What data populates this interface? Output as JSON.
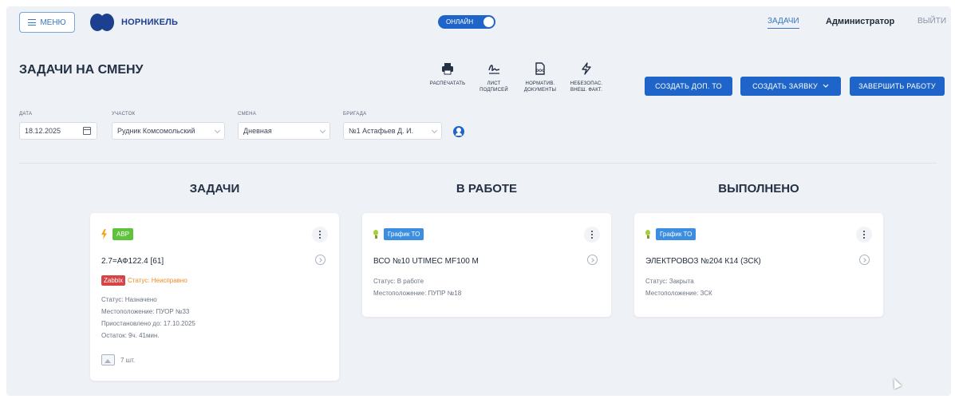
{
  "header": {
    "menu_label": "МЕНЮ",
    "logo_text": "НОРНИКЕЛЬ",
    "online_label": "ОНЛАЙН",
    "nav_tasks": "ЗАДАЧИ",
    "nav_admin": "Администратор",
    "nav_exit": "ВЫЙТИ"
  },
  "page": {
    "title": "ЗАДАЧИ НА СМЕНУ"
  },
  "tools": [
    {
      "icon": "printer-icon",
      "label_1": "РАСПЕЧАТАТЬ",
      "label_2": ""
    },
    {
      "icon": "signature-icon",
      "label_1": "ЛИСТ",
      "label_2": "ПОДПИСЕЙ"
    },
    {
      "icon": "document-icon",
      "label_1": "НОРМАТИВ.",
      "label_2": "ДОКУМЕНТЫ"
    },
    {
      "icon": "lightning-icon",
      "label_1": "НЕБЕЗОПАС.",
      "label_2": "ВНЕШ. ФАКТ."
    }
  ],
  "actions": {
    "create_extra_to": "СОЗДАТЬ ДОП. ТО",
    "create_request": "СОЗДАТЬ ЗАЯВКУ",
    "finish_work": "ЗАВЕРШИТЬ РАБОТУ"
  },
  "filters": {
    "date_label": "ДАТА",
    "date_value": "18.12.2025",
    "area_label": "УЧАСТОК",
    "area_value": "Рудник Комсомольский",
    "shift_label": "СМЕНА",
    "shift_value": "Дневная",
    "crew_label": "БРИГАДА",
    "crew_value": "№1 Астафьев Д. И."
  },
  "columns": {
    "todo": "ЗАДАЧИ",
    "in_progress": "В РАБОТЕ",
    "done": "ВЫПОЛНЕНО"
  },
  "cards": {
    "todo": {
      "badge": "АВР",
      "title": "2.7=АФ122.4 [61]",
      "zabbix": "Zabbix",
      "alert_status": "Статус: Неисправно",
      "status": "Статус: Назначено",
      "location": "Местоположение: ПУОР №33",
      "suspended": "Приостановлено до: 17.10.2025",
      "remaining": "Остаток: 9ч. 41мин.",
      "images": "7 шт."
    },
    "in_progress": {
      "badge": "График ТО",
      "title": "ВСО №10 UTIMEC MF100 M",
      "status": "Статус: В работе",
      "location": "Местоположение: ПУПР №18"
    },
    "done": {
      "badge": "График ТО",
      "title": "ЭЛЕКТРОВОЗ №204 К14 (ЗСК)",
      "status": "Статус: Закрыта",
      "location": "Местоположение: ЗСК"
    }
  },
  "colors": {
    "primary": "#1f64c8",
    "badge_green": "#5ec23a",
    "badge_blue": "#3b8ee0",
    "alert_orange": "#f08a24",
    "zabbix_red": "#d64545"
  }
}
